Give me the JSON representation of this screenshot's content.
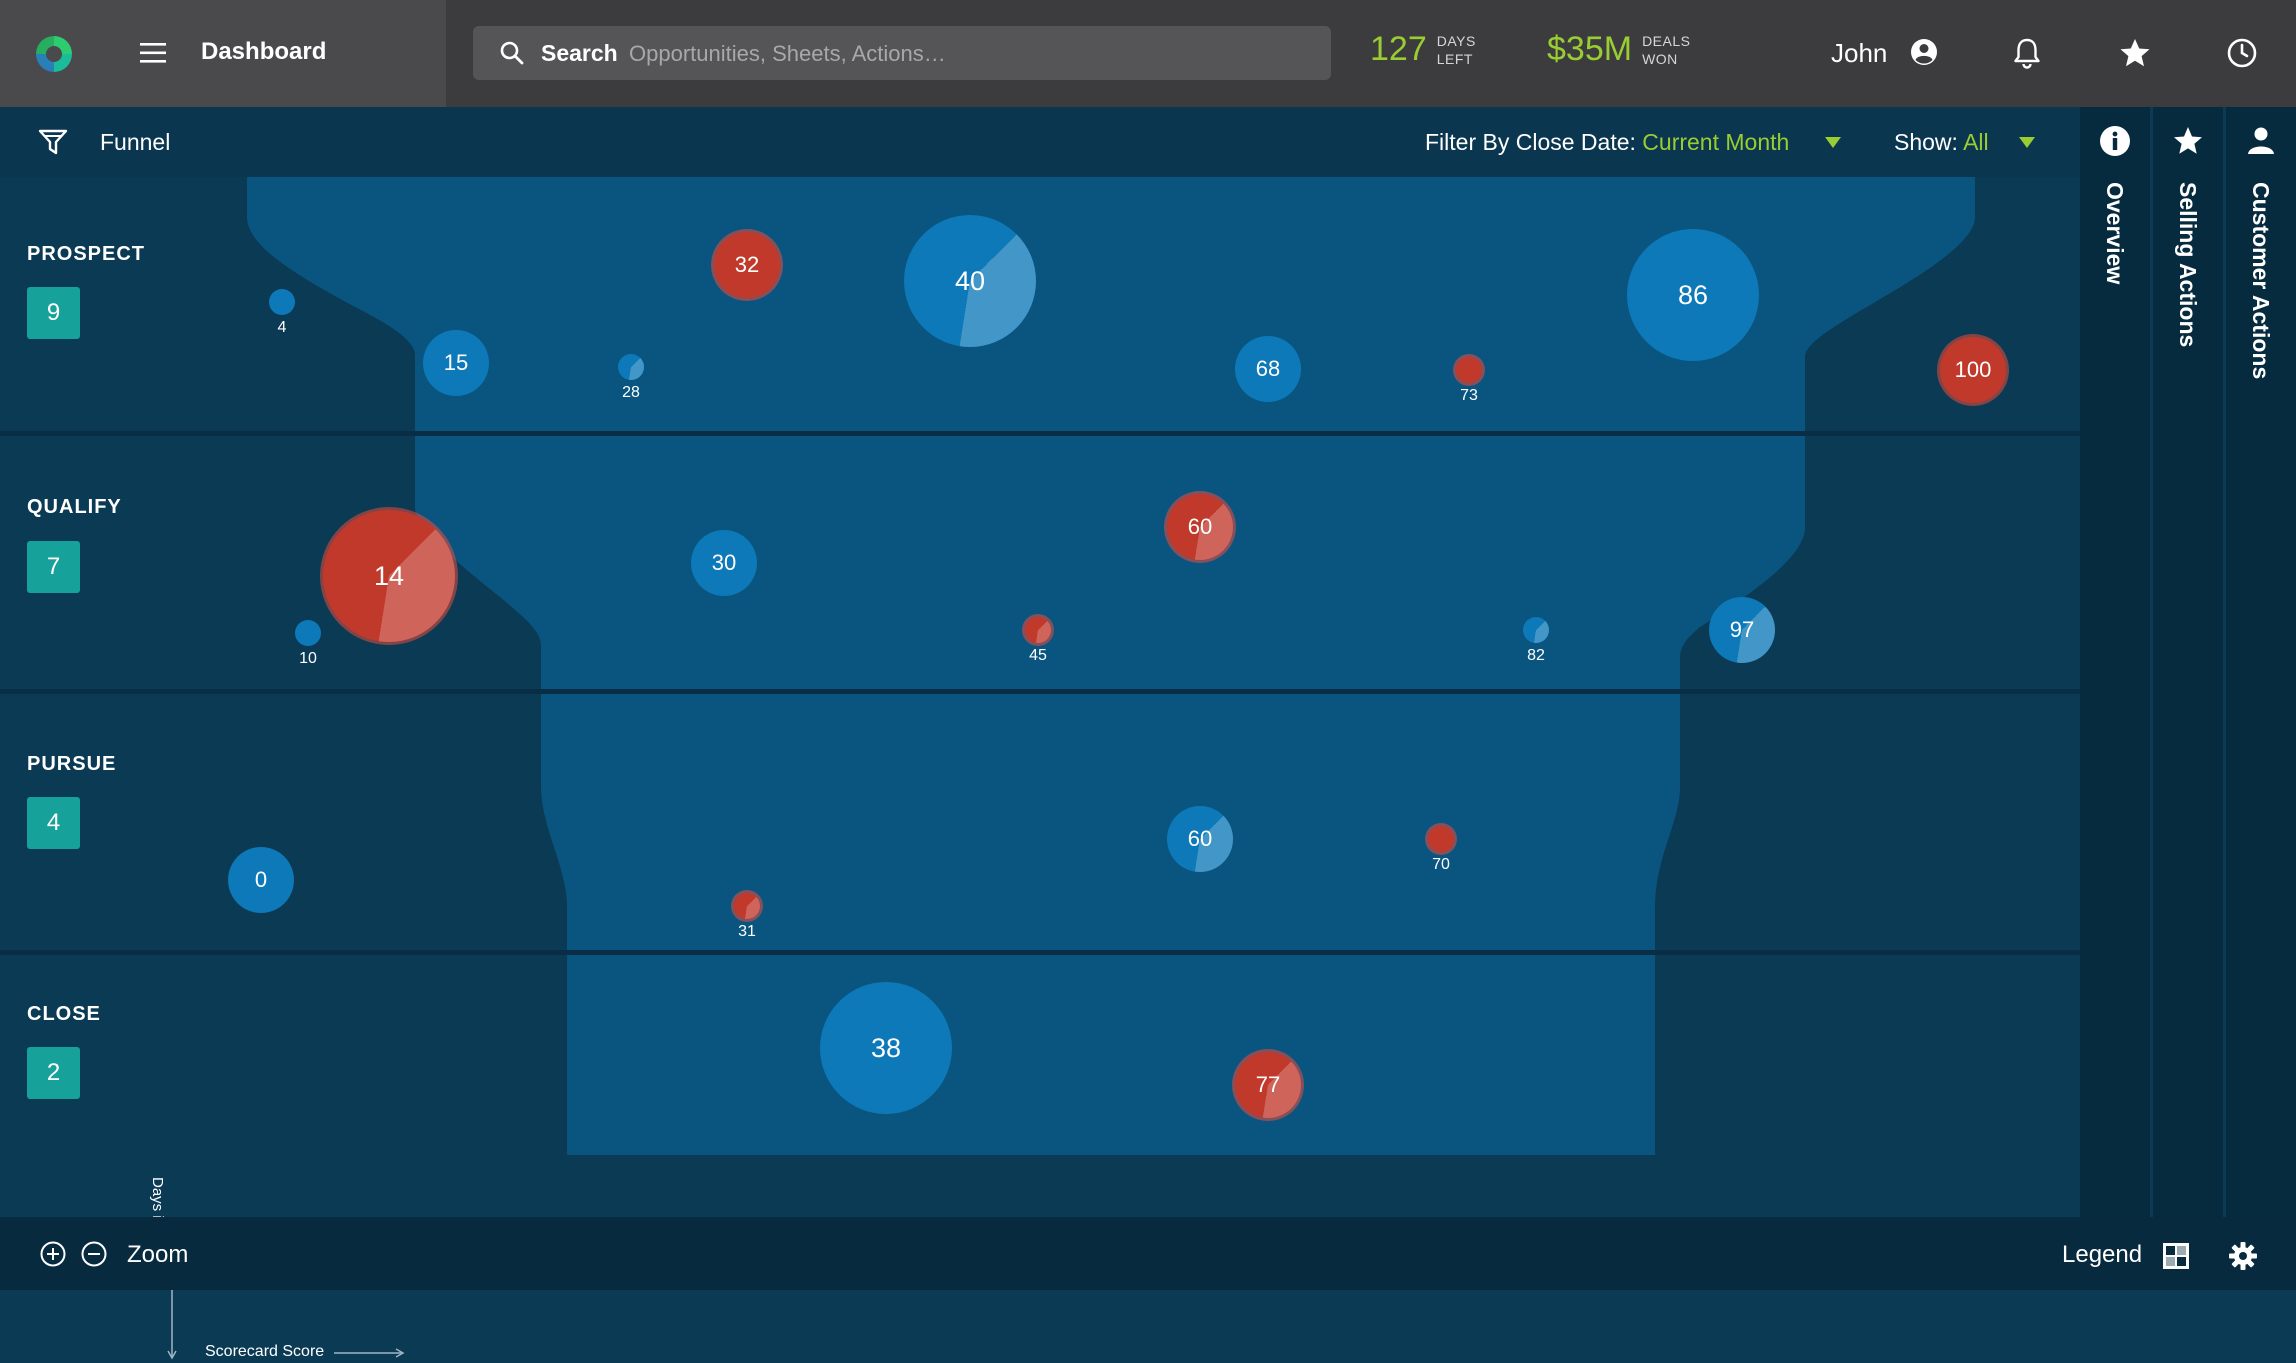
{
  "header": {
    "title": "Dashboard",
    "search_label": "Search",
    "search_placeholder": "Opportunities, Sheets, Actions…",
    "days_left_value": "127",
    "days_left_label_1": "DAYS",
    "days_left_label_2": "LEFT",
    "deals_won_value": "$35M",
    "deals_won_label_1": "DEALS",
    "deals_won_label_2": "WON",
    "user_name": "John"
  },
  "filter_bar": {
    "funnel_label": "Funnel",
    "close_date_label": "Filter By Close Date:",
    "close_date_value": "Current Month",
    "show_label": "Show:",
    "show_value": "All"
  },
  "stages": [
    {
      "name": "PROSPECT",
      "count": "9"
    },
    {
      "name": "QUALIFY",
      "count": "7"
    },
    {
      "name": "PURSUE",
      "count": "4"
    },
    {
      "name": "CLOSE",
      "count": "2"
    }
  ],
  "axes": {
    "y_label": "Days in Stage",
    "x_label": "Scorecard Score"
  },
  "bubbles": [
    {
      "label": "4",
      "color": "blue",
      "size": "xs",
      "label_below": true,
      "progress": 0
    },
    {
      "label": "15",
      "color": "blue",
      "size": "md",
      "label_below": false,
      "progress": 0
    },
    {
      "label": "28",
      "color": "blue",
      "size": "xs",
      "label_below": true,
      "progress": 0.4
    },
    {
      "label": "32",
      "color": "red",
      "size": "md",
      "label_below": false,
      "progress": 0
    },
    {
      "label": "40",
      "color": "blue",
      "size": "lg",
      "label_below": false,
      "progress": 0.4
    },
    {
      "label": "68",
      "color": "blue",
      "size": "md",
      "label_below": false,
      "progress": 0
    },
    {
      "label": "73",
      "color": "red",
      "size": "xs",
      "label_below": true,
      "progress": 0
    },
    {
      "label": "86",
      "color": "blue",
      "size": "lg",
      "label_below": false,
      "progress": 0
    },
    {
      "label": "100",
      "color": "red",
      "size": "md",
      "label_below": false,
      "progress": 0
    },
    {
      "label": "14",
      "color": "red",
      "size": "lg",
      "label_below": false,
      "progress": 0.4
    },
    {
      "label": "10",
      "color": "blue",
      "size": "xs",
      "label_below": true,
      "progress": 0
    },
    {
      "label": "30",
      "color": "blue",
      "size": "md",
      "label_below": false,
      "progress": 0
    },
    {
      "label": "60",
      "color": "red",
      "size": "md",
      "label_below": false,
      "progress": 0.4
    },
    {
      "label": "45",
      "color": "red",
      "size": "xs",
      "label_below": true,
      "progress": 0.4
    },
    {
      "label": "82",
      "color": "blue",
      "size": "xs",
      "label_below": true,
      "progress": 0.4
    },
    {
      "label": "97",
      "color": "blue",
      "size": "md",
      "label_below": false,
      "progress": 0.4
    },
    {
      "label": "0",
      "color": "blue",
      "size": "md",
      "label_below": false,
      "progress": 0
    },
    {
      "label": "31",
      "color": "red",
      "size": "xs",
      "label_below": true,
      "progress": 0.4
    },
    {
      "label": "60",
      "color": "blue",
      "size": "md",
      "label_below": false,
      "progress": 0.4
    },
    {
      "label": "70",
      "color": "red",
      "size": "xs",
      "label_below": true,
      "progress": 0
    },
    {
      "label": "38",
      "color": "blue",
      "size": "lg",
      "label_below": false,
      "progress": 0
    },
    {
      "label": "77",
      "color": "red",
      "size": "md",
      "label_below": false,
      "progress": 0.4
    }
  ],
  "side_panels": [
    {
      "label": "Overview",
      "icon": "info-icon"
    },
    {
      "label": "Selling Actions",
      "icon": "star-icon"
    },
    {
      "label": "Customer Actions",
      "icon": "person-icon"
    }
  ],
  "footer": {
    "zoom_label": "Zoom",
    "legend_label": "Legend"
  },
  "colors": {
    "accent": "#9acd32",
    "bubble_blue": "#0d79b8",
    "bubble_red": "#c0392b",
    "stage_badge": "#16a29a"
  }
}
